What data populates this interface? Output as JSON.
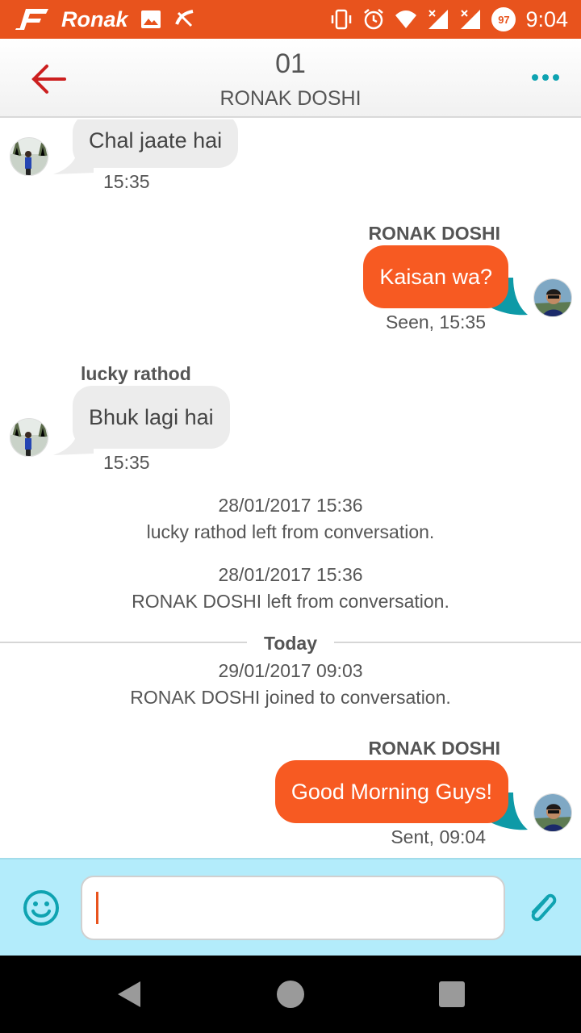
{
  "status_bar": {
    "carrier": "Ronak",
    "time": "9:04",
    "battery_level": "97",
    "icons": [
      "app-logo-icon",
      "image-icon",
      "missed-call-icon",
      "vibrate-icon",
      "alarm-icon",
      "wifi-icon",
      "signal-icon",
      "signal-icon"
    ]
  },
  "header": {
    "title": "01",
    "subtitle": "RONAK DOSHI"
  },
  "messages": [
    {
      "direction": "incoming",
      "sender": "",
      "text": "Chal jaate hai",
      "meta": "15:35"
    },
    {
      "direction": "outgoing",
      "sender": "RONAK DOSHI",
      "text": "Kaisan wa?",
      "meta": "Seen, 15:35"
    },
    {
      "direction": "incoming",
      "sender": "lucky rathod",
      "text": "Bhuk lagi hai",
      "meta": "15:35"
    },
    {
      "direction": "system",
      "time": "28/01/2017 15:36",
      "text": "lucky rathod left from conversation."
    },
    {
      "direction": "system",
      "time": "28/01/2017 15:36",
      "text": "RONAK DOSHI left from conversation."
    },
    {
      "direction": "divider",
      "text": "Today"
    },
    {
      "direction": "system",
      "time": "29/01/2017 09:03",
      "text": "RONAK DOSHI joined to conversation."
    },
    {
      "direction": "outgoing",
      "sender": "RONAK DOSHI",
      "text": "Good Morning Guys!",
      "meta": "Sent, 09:04"
    }
  ],
  "composer": {
    "value": "",
    "placeholder": ""
  },
  "colors": {
    "status_bar": "#e8531d",
    "outgoing_bubble": "#f75a22",
    "incoming_bubble": "#ececec",
    "accent_teal": "#0fa3b1",
    "back_arrow": "#cc1f1f",
    "composer_bg": "#b3ecfb"
  }
}
